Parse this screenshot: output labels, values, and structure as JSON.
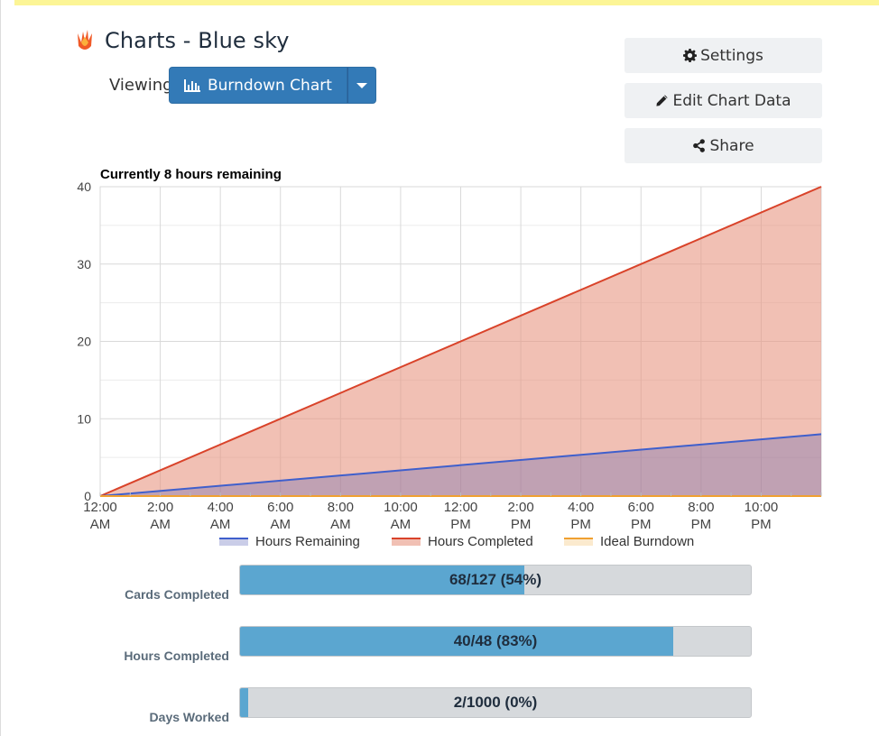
{
  "app": {
    "title": "Charts - Blue sky",
    "viewing_label": "Viewing",
    "view_button_label": "Burndown Chart"
  },
  "actions": {
    "settings": "Settings",
    "edit_chart_data": "Edit Chart Data",
    "share": "Share"
  },
  "colors": {
    "accent": "#337ab7",
    "hours_remaining": "#3f5fcc",
    "hours_completed": "#d9432a",
    "ideal_burndown": "#f0a030",
    "top_banner": "#fcf596",
    "progress_fill": "#5ba6d0"
  },
  "chart_data": {
    "type": "area",
    "title": "Currently 8 hours remaining",
    "x_categories": [
      "12:00 AM",
      "2:00 AM",
      "4:00 AM",
      "6:00 AM",
      "8:00 AM",
      "10:00 AM",
      "12:00 PM",
      "2:00 PM",
      "4:00 PM",
      "6:00 PM",
      "8:00 PM",
      "10:00 PM"
    ],
    "x_range_hours": [
      0,
      24
    ],
    "ylim": [
      0,
      40
    ],
    "yticks": [
      "0",
      "10",
      "20",
      "30",
      "40"
    ],
    "series": [
      {
        "name": "Hours Remaining",
        "x": [
          0,
          24
        ],
        "y": [
          0,
          8
        ]
      },
      {
        "name": "Hours Completed",
        "x": [
          0,
          24
        ],
        "y": [
          0,
          40
        ]
      },
      {
        "name": "Ideal Burndown",
        "x": [
          0,
          24
        ],
        "y": [
          0,
          0
        ]
      }
    ],
    "grid": true,
    "legend": "bottom"
  },
  "stats": [
    {
      "label": "Cards Completed",
      "text": "68/127 (54%)",
      "fraction": 0.557
    },
    {
      "label": "Hours Completed",
      "text": "40/48 (83%)",
      "fraction": 0.848
    },
    {
      "label": "Days Worked",
      "text": "2/1000 (0%)",
      "fraction": 0.016
    }
  ]
}
